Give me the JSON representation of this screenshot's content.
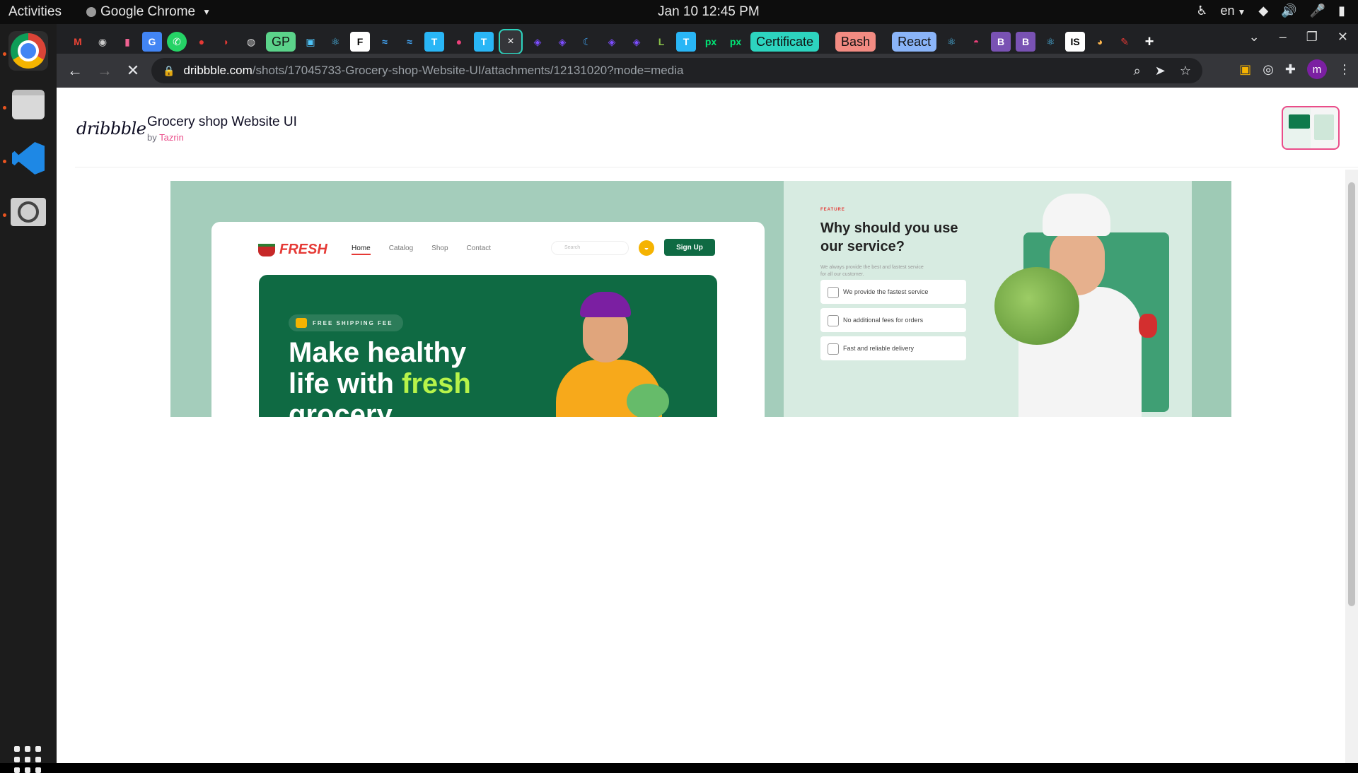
{
  "system": {
    "activities": "Activities",
    "app_name": "Google Chrome",
    "clock": "Jan 10  12:45 PM",
    "language": "en"
  },
  "browser": {
    "tab_groups": [
      "GP",
      "Certificate",
      "Bash",
      "React"
    ],
    "tab_group_colors": {
      "GP": "#5bd38a",
      "Certificate": "#2dd4bf",
      "Bash": "#f28b82",
      "React": "#8ab4f8"
    },
    "active_tab_close": "×",
    "url_domain": "dribbble.com",
    "url_path": "/shots/17045733-Grocery-shop-Website-UI/attachments/12131020?mode=media",
    "profile_initial": "m"
  },
  "shot": {
    "logo": "dribbble",
    "title": "Grocery shop Website UI",
    "by_prefix": "by",
    "author": "Tazrin"
  },
  "mockup": {
    "brand": "FRESH",
    "nav": [
      "Home",
      "Catalog",
      "Shop",
      "Contact"
    ],
    "search_placeholder": "Search",
    "signup": "Sign Up",
    "shipping_tag": "FREE SHIPPING FEE",
    "headline_1": "Make healthy",
    "headline_2": "life with",
    "headline_fresh": "fresh",
    "headline_3": "grocery",
    "feature_tag": "FEATURE",
    "feature_title": "Why should you use our service?",
    "feature_subtitle": "We always provide the best and fastest service for all our customer.",
    "features": [
      "We provide the fastest service",
      "No additional fees for orders",
      "Fast and reliable delivery"
    ]
  }
}
